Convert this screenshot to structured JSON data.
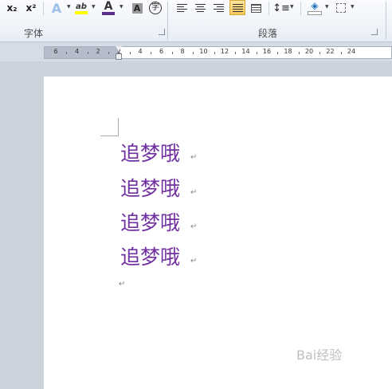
{
  "ribbon": {
    "font_group_label": "字体",
    "paragraph_group_label": "段落",
    "font_color": "#5b2c8f",
    "highlight_color": "#ffff00",
    "highlight_glyph": "ab",
    "font_color_glyph": "A",
    "char_shade_glyph": "A",
    "enclose_glyph": "字",
    "subscript_glyph": "x₂",
    "superscript_glyph": "x²",
    "text_effects_glyph": "A"
  },
  "ruler": {
    "labels": [
      "6",
      "4",
      "2",
      "2",
      "4",
      "6",
      "8",
      "10",
      "12",
      "14",
      "16",
      "18",
      "20",
      "22",
      "24"
    ]
  },
  "document": {
    "paragraphs": [
      "追梦哦",
      "追梦哦",
      "追梦哦",
      "追梦哦"
    ],
    "text_color": "#7030a0",
    "paragraph_mark": "↵"
  },
  "watermark": "Bai经验"
}
